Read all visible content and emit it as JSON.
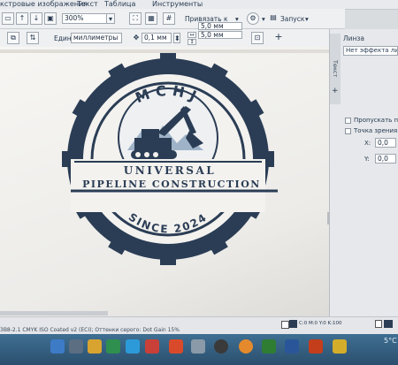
{
  "menubar": {
    "items": [
      "кстровые изображения",
      "Текст",
      "Таблица",
      "Инструменты"
    ]
  },
  "toolbar1": {
    "zoom": "300%",
    "snap_label": "Привязать к",
    "launch_label": "Запуск"
  },
  "toolbar2": {
    "units_label": "Единицы:",
    "units_value": "миллиметры",
    "nudge_value": "0,1 мм",
    "dup_x": "5,0 мм",
    "dup_y": "5,0 мм"
  },
  "panel": {
    "title": "Линза",
    "effect_value": "Нет эффекта линзы",
    "tab_label": "Текст",
    "skip_label": "Пропускать пу",
    "viewpoint_label": "Точка зрения",
    "x_label": "X:",
    "x_value": "0,0",
    "y_label": "Y:",
    "y_value": "0,0"
  },
  "logo": {
    "monogram": "MCHJ",
    "line1": "UNIVERSAL",
    "line2": "PIPELINE CONSTRUCTION",
    "since": "SINCE 2024",
    "color": "#2b3d55"
  },
  "status": {
    "color_readout": "C:0 M:0 Y:0 K:100",
    "profile_text": "3B8-2.1 CMYK ISO Coated v2 (ECI); Оттенки серого: Dot Gain 15%",
    "tray_temp": "5°C"
  },
  "colors": {
    "taskbar": "#2f5878",
    "navy": "#2b3d55"
  }
}
